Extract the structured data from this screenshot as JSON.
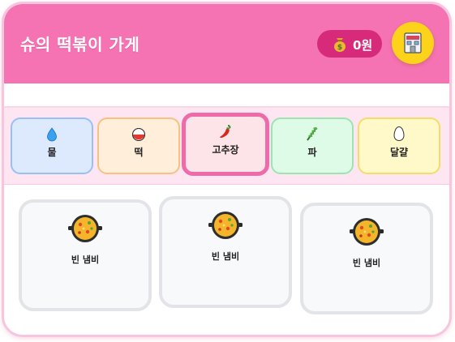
{
  "header": {
    "title": "슈의 떡볶이 가게",
    "coins": "0원",
    "coin_icon": "money-bag-icon",
    "shop_icon": "shop-icon"
  },
  "colors": {
    "header": "#f572b3",
    "coin_badge": "#d82a7a",
    "shop_button": "#fcd21b",
    "selected_border": "#ef6aa9"
  },
  "ingredients": [
    {
      "label": "물",
      "icon": "water-drop-icon",
      "bg": "#dde9fd",
      "border": "#98c0f2"
    },
    {
      "label": "떡",
      "icon": "rice-cake-icon",
      "bg": "#ffeed9",
      "border": "#f7c184"
    },
    {
      "label": "고추장",
      "icon": "chili-pepper-icon",
      "bg": "#fde4e8",
      "border": "#ef6aa9",
      "selected": true
    },
    {
      "label": "파",
      "icon": "green-onion-icon",
      "bg": "#ddfbe6",
      "border": "#9ee4b0"
    },
    {
      "label": "달걀",
      "icon": "egg-icon",
      "bg": "#fff9c9",
      "border": "#f5dc6a"
    }
  ],
  "pots": [
    {
      "label": "빈 냄비"
    },
    {
      "label": "빈 냄비"
    },
    {
      "label": "빈 냄비"
    }
  ]
}
